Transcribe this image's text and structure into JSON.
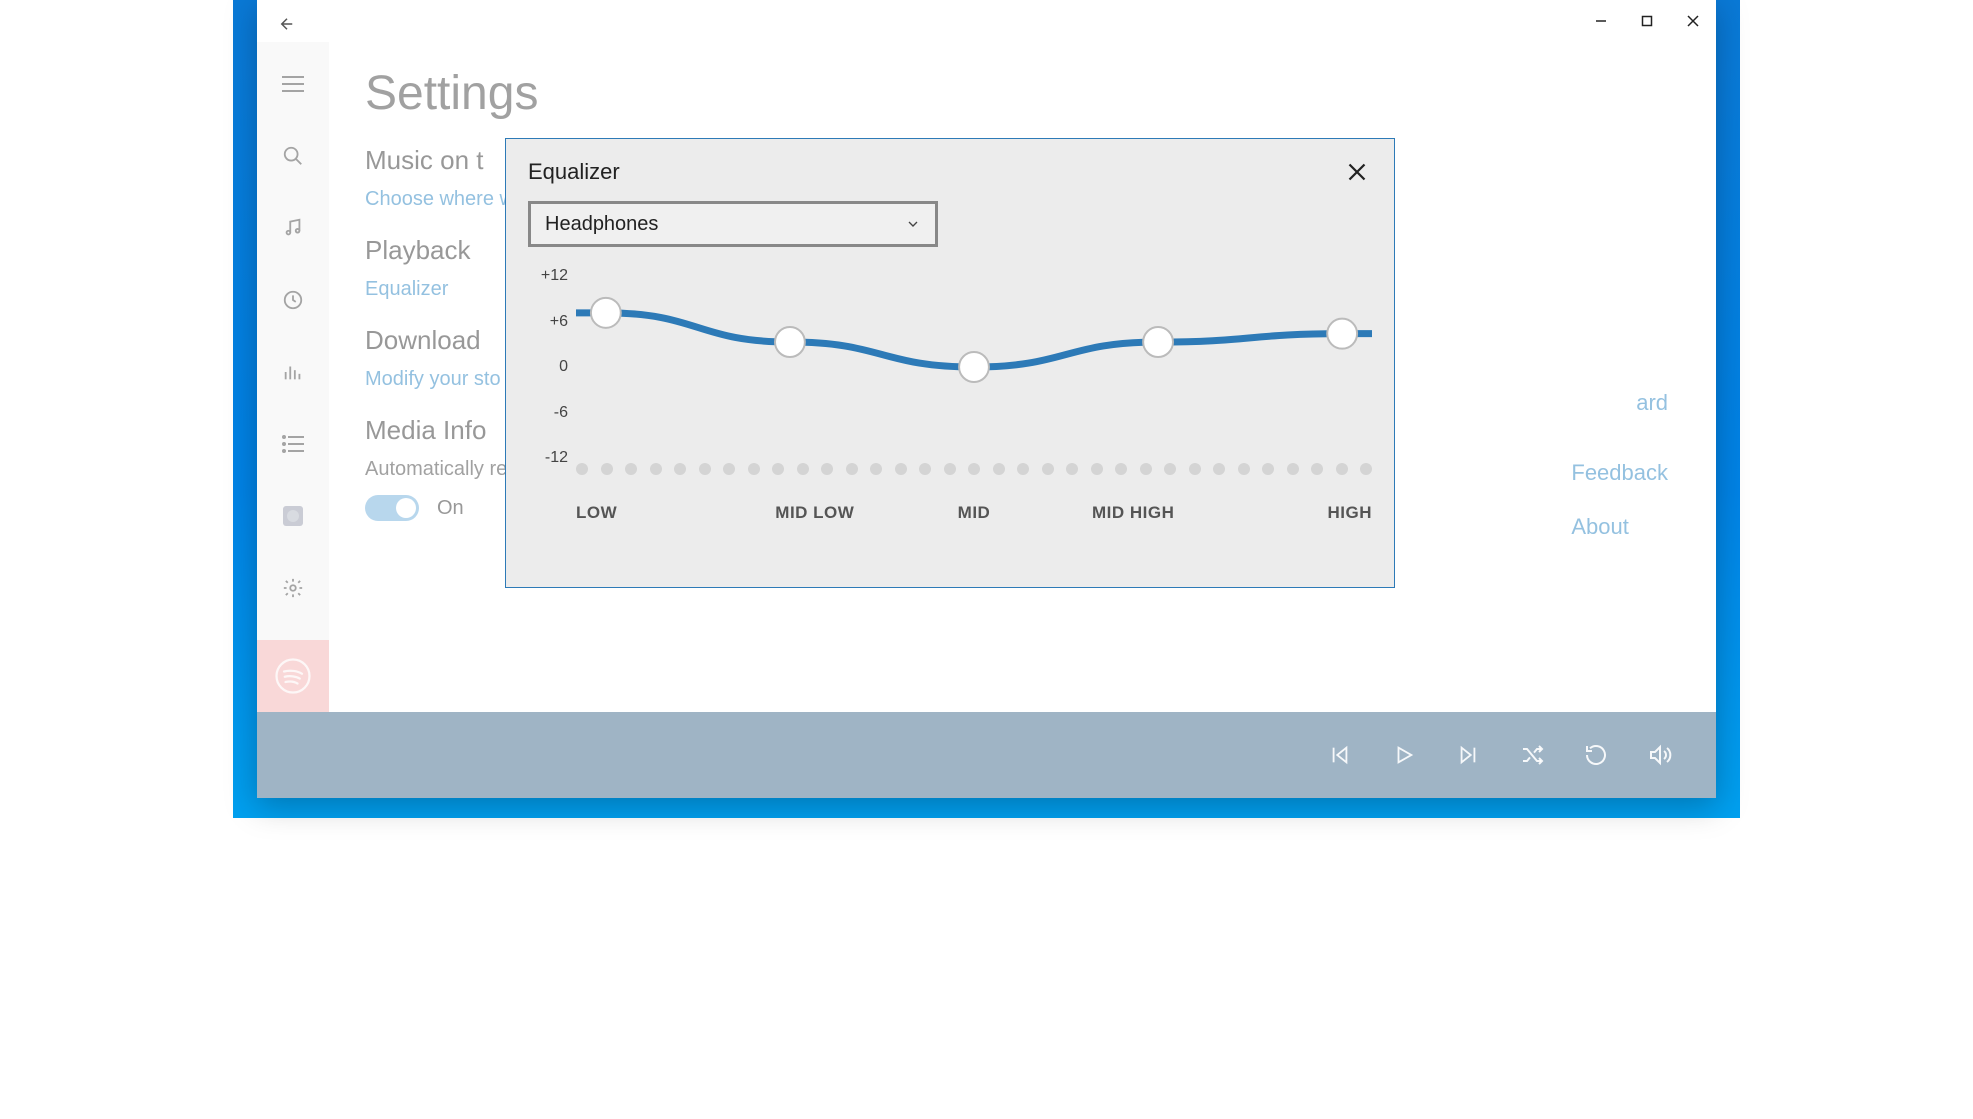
{
  "page": {
    "title": "Settings",
    "sections": {
      "music": {
        "heading": "Music on t",
        "link": "Choose where w"
      },
      "playback": {
        "heading": "Playback",
        "link": "Equalizer"
      },
      "downloads": {
        "heading": "Download",
        "link": "Modify your sto",
        "right_hint": "ard"
      },
      "media_info": {
        "heading": "Media Info",
        "sub": "Automatically re",
        "toggle_state": "On"
      }
    },
    "right_links": {
      "feedback": "Feedback",
      "about": "About"
    }
  },
  "modal": {
    "title": "Equalizer",
    "preset": "Headphones"
  },
  "chart_data": {
    "type": "line",
    "title": "Equalizer",
    "xlabel": "",
    "ylabel": "",
    "ylim": [
      -12,
      12
    ],
    "y_ticks": [
      "+12",
      "+6",
      "0",
      "-6",
      "-12"
    ],
    "categories": [
      "LOW",
      "MID LOW",
      "MID",
      "MID HIGH",
      "HIGH"
    ],
    "values": [
      6.5,
      3,
      0,
      3,
      4
    ]
  },
  "accent_color": "#2d7ab7"
}
